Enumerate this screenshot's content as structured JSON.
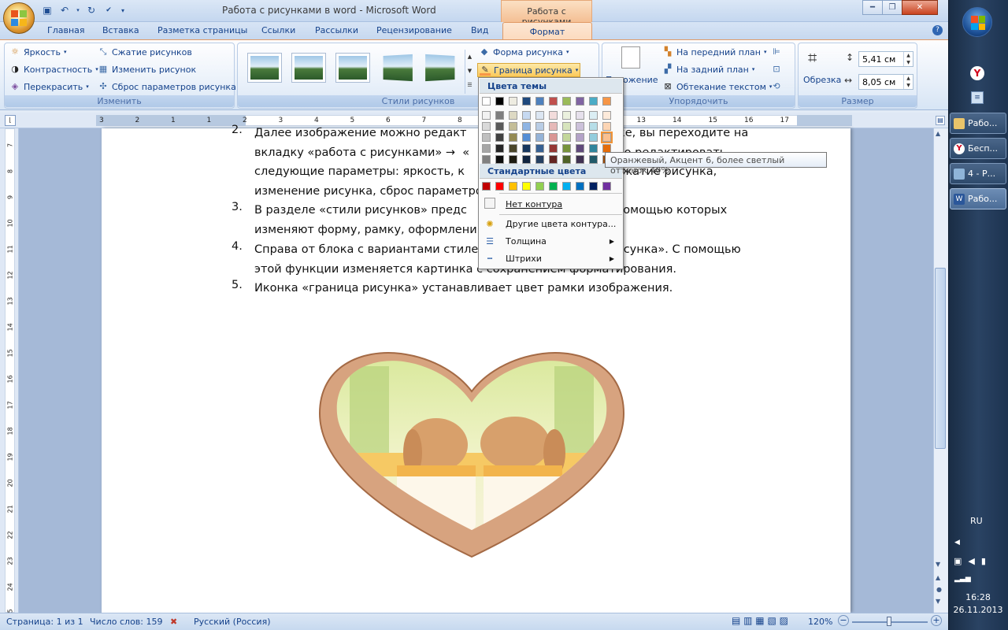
{
  "window": {
    "title": "Работа с рисунками в word - Microsoft Word",
    "context_title": "Работа с рисунками"
  },
  "tabs": [
    "Главная",
    "Вставка",
    "Разметка страницы",
    "Ссылки",
    "Рассылки",
    "Рецензирование",
    "Вид"
  ],
  "active_tab": "Формат",
  "ribbon": {
    "adjust": {
      "brightness": "Яркость",
      "contrast": "Контрастность",
      "recolor": "Перекрасить",
      "compress": "Сжатие рисунков",
      "change": "Изменить рисунок",
      "reset": "Сброс параметров рисунка",
      "label": "Изменить"
    },
    "styles": {
      "label": "Стили рисунков",
      "shape": "Форма рисунка",
      "border": "Граница рисунка"
    },
    "arrange": {
      "position": "Положение",
      "front": "На передний план",
      "back": "На задний план",
      "wrap": "Обтекание текстом",
      "label": "Упорядочить"
    },
    "size": {
      "crop": "Обрезка",
      "height": "5,41 см",
      "width": "8,05 см",
      "label": "Размер"
    }
  },
  "border_menu": {
    "theme_colors_header": "Цвета темы",
    "standard_colors_header": "Стандартные цвета",
    "theme_top": [
      "#ffffff",
      "#000000",
      "#eeece1",
      "#1f497d",
      "#4f81bd",
      "#c0504d",
      "#9bbb59",
      "#8064a2",
      "#4bacc6",
      "#f79646"
    ],
    "theme_shades": [
      [
        "#f2f2f2",
        "#d9d9d9",
        "#bfbfbf",
        "#a6a6a6",
        "#808080"
      ],
      [
        "#7f7f7f",
        "#595959",
        "#404040",
        "#262626",
        "#0d0d0d"
      ],
      [
        "#ddd9c3",
        "#c4bd97",
        "#948a54",
        "#4a452a",
        "#1e1c11"
      ],
      [
        "#c6d9f1",
        "#8eb4e3",
        "#558ed5",
        "#17375e",
        "#10243f"
      ],
      [
        "#dce6f2",
        "#b9cde5",
        "#95b3d7",
        "#376092",
        "#254061"
      ],
      [
        "#f2dcdb",
        "#e6b9b8",
        "#d99694",
        "#953735",
        "#632523"
      ],
      [
        "#ebf1de",
        "#d7e4bd",
        "#c3d69b",
        "#77933c",
        "#4f6228"
      ],
      [
        "#e6e0ec",
        "#ccc1da",
        "#b3a2c7",
        "#604a7b",
        "#403152"
      ],
      [
        "#dbeef4",
        "#b7dee8",
        "#93cddd",
        "#31859c",
        "#215968"
      ],
      [
        "#fdeada",
        "#fcd5b5",
        "#fac090",
        "#e46c0a",
        "#984807"
      ]
    ],
    "standard": [
      "#c00000",
      "#ff0000",
      "#ffc000",
      "#ffff00",
      "#92d050",
      "#00b050",
      "#00b0f0",
      "#0070c0",
      "#002060",
      "#7030a0"
    ],
    "no_outline": "Нет контура",
    "more_colors": "Другие цвета контура...",
    "weight": "Толщина",
    "dashes": "Штрихи",
    "tooltip": "Оранжевый, Акцент 6, более светлый оттенок 40%"
  },
  "document": {
    "items": [
      {
        "num": "2.",
        "lines": [
          "Далее изображение можно редакт                              картинке, вы переходите на",
          "вкладку «работа с рисунками» →  «                           [...] можно редактировать",
          "следующие параметры: яркость, к                         ие цвета, сжатие рисунка,",
          "изменение рисунка, сброс параметро"
        ]
      },
      {
        "num": "3.",
        "lines": [
          "В разделе «стили рисунков» предс                          разцы, с помощью которых",
          "изменяют форму, рамку, оформлени"
        ]
      },
      {
        "num": "4.",
        "lines": [
          "Справа от блока с вариантами стилей                      форма рисунка». С помощью",
          "этой функции изменяется картинка с сохранением форматирования."
        ]
      },
      {
        "num": "5.",
        "lines": [
          "Иконка «граница рисунка» устанавливает цвет рамки изображения."
        ]
      }
    ]
  },
  "statusbar": {
    "page": "Страница: 1 из 1",
    "words": "Число слов: 159",
    "lang": "Русский (Россия)",
    "zoom": "120%"
  },
  "taskbar": {
    "items": [
      "Рабо...",
      "Бесп...",
      "4 - Р...",
      "Рабо..."
    ],
    "lang": "RU",
    "time": "16:28",
    "date": "26.11.2013"
  },
  "ruler": {
    "h_ticks": [
      "3",
      "2",
      "1",
      "1",
      "2",
      "3",
      "4",
      "5",
      "6",
      "7",
      "8",
      "9",
      "10",
      "11",
      "12",
      "13",
      "14",
      "15",
      "16",
      "17"
    ],
    "v_ticks": [
      "7",
      "8",
      "9",
      "10",
      "11",
      "12",
      "13",
      "14",
      "15",
      "16",
      "17",
      "18",
      "19",
      "20",
      "21",
      "22",
      "23",
      "24",
      "25"
    ]
  }
}
